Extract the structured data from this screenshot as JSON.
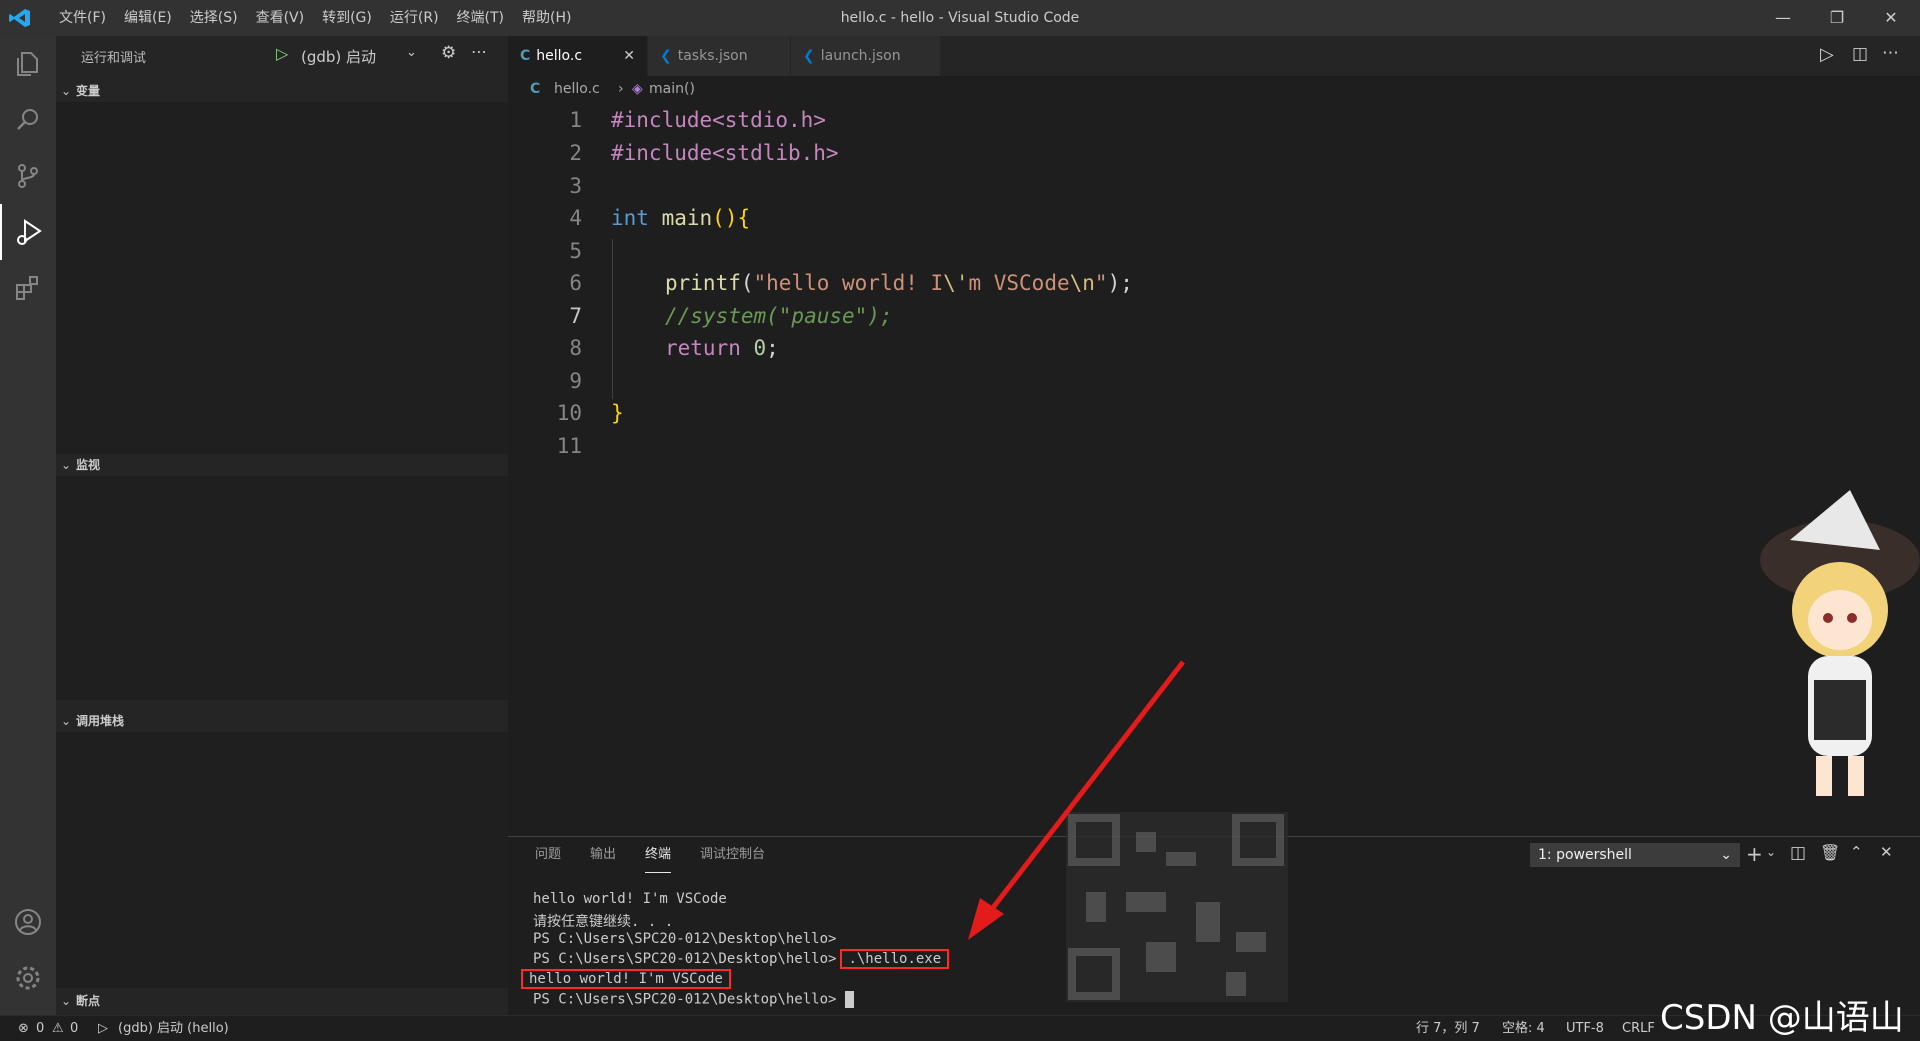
{
  "titlebar": {
    "menu": [
      "文件(F)",
      "编辑(E)",
      "选择(S)",
      "查看(V)",
      "转到(G)",
      "运行(R)",
      "终端(T)",
      "帮助(H)"
    ],
    "title": "hello.c - hello - Visual Studio Code"
  },
  "sidebar": {
    "title": "运行和调试",
    "config": "(gdb) 启动",
    "sections": {
      "variables": "变量",
      "watch": "监视",
      "callstack": "调用堆栈",
      "breakpoints": "断点"
    }
  },
  "tabs": [
    {
      "label": "hello.c",
      "icon": "c-file-icon"
    },
    {
      "label": "tasks.json",
      "icon": "vscode-icon"
    },
    {
      "label": "launch.json",
      "icon": "vscode-icon"
    }
  ],
  "breadcrumb": {
    "file": "hello.c",
    "symbol": "main()"
  },
  "editor": {
    "line_numbers": [
      "1",
      "2",
      "3",
      "4",
      "5",
      "6",
      "7",
      "8",
      "9",
      "10",
      "11"
    ],
    "current_line": 7,
    "lines": {
      "l1": "#include<stdio.h>",
      "l2": "#include<stdlib.h>",
      "l4_kw": "int",
      "l4_fn": "main",
      "l4_rest": "(){",
      "l6_fn": "printf",
      "l6_str1": "\"hello world! I",
      "l6_esc1": "\\'",
      "l6_str2": "m VSCode",
      "l6_esc2": "\\n",
      "l6_str3": "\"",
      "l6_end": ");",
      "l7": "//system(\"pause\");",
      "l8_kw": "return",
      "l8_num": "0",
      "l8_end": ";",
      "l10": "}"
    }
  },
  "panel": {
    "tabs": [
      "问题",
      "输出",
      "终端",
      "调试控制台"
    ],
    "active_tab": "终端",
    "terminal_select": "1: powershell",
    "terminal_lines": [
      "hello world! I'm VSCode",
      "请按任意键继续. . .",
      "PS C:\\Users\\SPC20-012\\Desktop\\hello>",
      "PS C:\\Users\\SPC20-012\\Desktop\\hello>",
      "hello world! I'm VSCode",
      "PS C:\\Users\\SPC20-012\\Desktop\\hello>"
    ],
    "command": ".\\hello.exe"
  },
  "statusbar": {
    "errors": "0",
    "warnings": "0",
    "debug": "(gdb) 启动 (hello)",
    "position": "行 7，列 7",
    "spaces": "空格: 4",
    "encoding": "UTF-8",
    "eol": "CRLF"
  },
  "watermark": "CSDN @山语山",
  "colors": {
    "accent": "#007acc",
    "highlight": "#ff2b2b",
    "arrow": "#e31b1b"
  }
}
